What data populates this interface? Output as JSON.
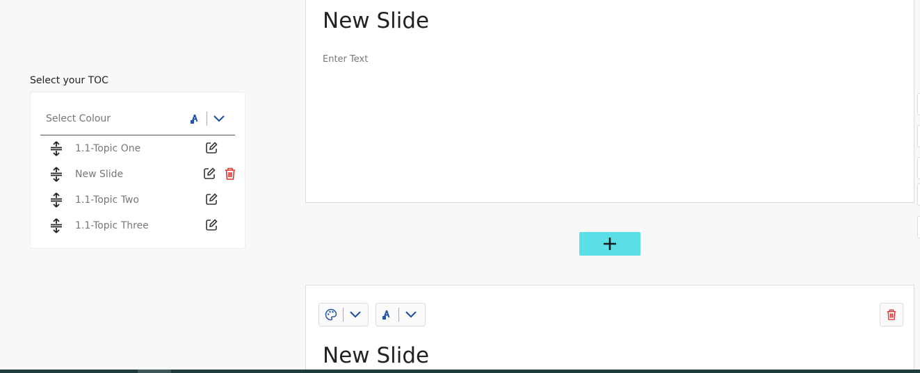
{
  "toc": {
    "title": "Select your TOC",
    "colour_placeholder": "Select Colour",
    "items": [
      {
        "label": "1.1-Topic One"
      },
      {
        "label": "New Slide"
      },
      {
        "label": "1.1-Topic Two"
      },
      {
        "label": "1.1-Topic Three"
      }
    ]
  },
  "slides": [
    {
      "title": "New Slide",
      "body_placeholder": "Enter Text"
    },
    {
      "title": "New Slide"
    }
  ],
  "colors": {
    "accent_blue": "#2453a6",
    "add_button": "#5bdfe6",
    "delete_red": "#d9302c"
  },
  "icons": {
    "drag": "drag-handle-icon",
    "edit": "edit-icon",
    "delete": "trash-icon",
    "palette": "palette-icon",
    "font": "font-color-icon",
    "chevron": "chevron-down-icon",
    "add": "plus-icon"
  }
}
